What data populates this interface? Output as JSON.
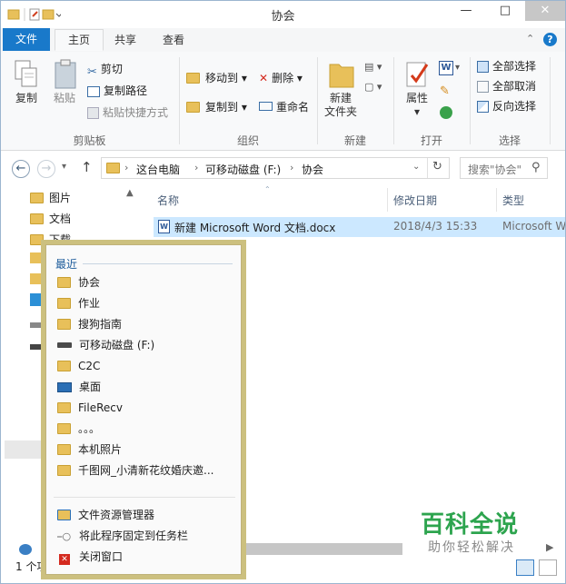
{
  "window": {
    "title": "协会"
  },
  "ribbon_tabs": [
    "文件",
    "主页",
    "共享",
    "查看"
  ],
  "ribbon": {
    "clipboard": {
      "copy": "复制",
      "paste": "粘贴",
      "cut": "剪切",
      "copy_path": "复制路径",
      "paste_shortcut": "粘贴快捷方式",
      "label": "剪贴板"
    },
    "organize": {
      "move_to": "移动到",
      "copy_to": "复制到",
      "delete": "删除",
      "rename": "重命名",
      "label": "组织"
    },
    "new": {
      "new_folder_line1": "新建",
      "new_folder_line2": "文件夹",
      "label": "新建"
    },
    "open": {
      "properties": "属性",
      "label": "打开"
    },
    "select": {
      "select_all": "全部选择",
      "select_none": "全部取消",
      "invert": "反向选择",
      "label": "选择"
    }
  },
  "address": {
    "crumbs": [
      "这台电脑",
      "可移动磁盘 (F:)",
      "协会"
    ],
    "search_placeholder": "搜索\"协会\""
  },
  "navpane": [
    "图片",
    "文档",
    "下载"
  ],
  "columns": [
    "名称",
    "修改日期",
    "类型"
  ],
  "files": [
    {
      "name": "新建 Microsoft Word 文档.docx",
      "date": "2018/4/3 15:33",
      "type": "Microsoft W"
    }
  ],
  "jumplist": {
    "heading": "最近",
    "recent": [
      {
        "label": "协会",
        "icon": "folder-icon"
      },
      {
        "label": "作业",
        "icon": "folder-icon"
      },
      {
        "label": "搜狗指南",
        "icon": "folder-icon"
      },
      {
        "label": "可移动磁盘 (F:)",
        "icon": "drive-icon"
      },
      {
        "label": "C2C",
        "icon": "folder-icon"
      },
      {
        "label": "桌面",
        "icon": "desktop-icon"
      },
      {
        "label": "FileRecv",
        "icon": "folder-icon"
      },
      {
        "label": "。。。",
        "icon": "folder-icon"
      },
      {
        "label": "本机照片",
        "icon": "folder-icon"
      },
      {
        "label": "千图网_小清新花纹婚庆邀...",
        "icon": "folder-icon"
      }
    ],
    "tasks": [
      "文件资源管理器",
      "将此程序固定到任务栏",
      "关闭窗口"
    ]
  },
  "status": {
    "items": "1 个项"
  },
  "watermark": {
    "title": "百科全说",
    "subtitle": "助你轻松解决"
  },
  "colors": {
    "file_tab": "#1979ca",
    "selection": "#cce8ff",
    "jump_border": "#ccc07f",
    "watermark": "#2da44e"
  }
}
